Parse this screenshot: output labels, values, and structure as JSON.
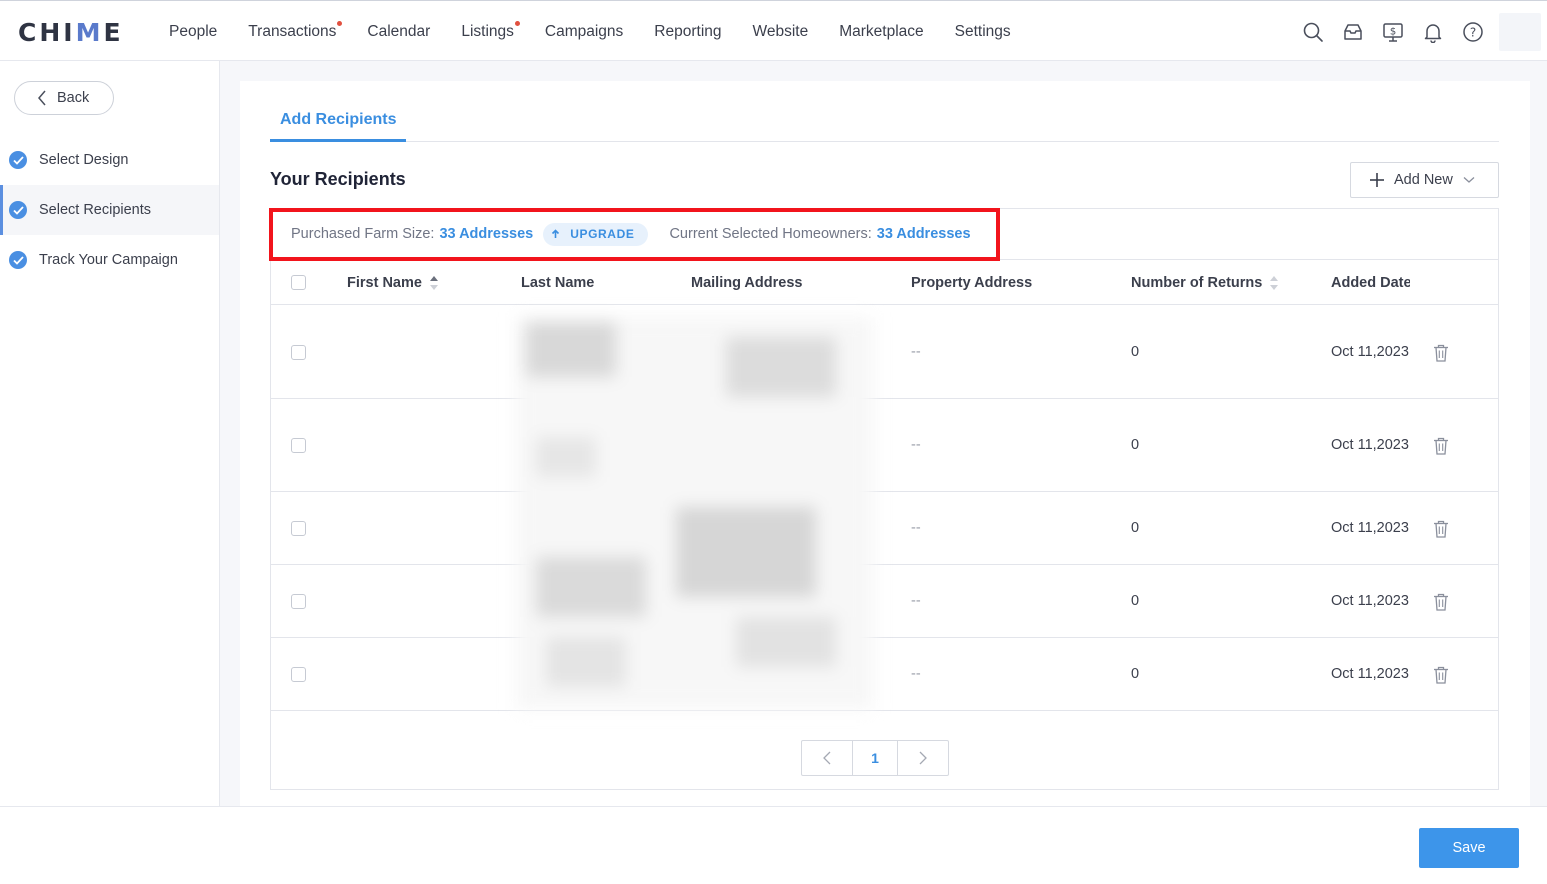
{
  "app": {
    "logo": "CHIME"
  },
  "nav": [
    {
      "label": "People",
      "dot": false
    },
    {
      "label": "Transactions",
      "dot": true
    },
    {
      "label": "Calendar",
      "dot": false
    },
    {
      "label": "Listings",
      "dot": true
    },
    {
      "label": "Campaigns",
      "dot": false
    },
    {
      "label": "Reporting",
      "dot": false
    },
    {
      "label": "Website",
      "dot": false
    },
    {
      "label": "Marketplace",
      "dot": false
    },
    {
      "label": "Settings",
      "dot": false
    }
  ],
  "header_icons": [
    "search-icon",
    "inbox-icon",
    "billing-icon",
    "bell-icon",
    "help-icon"
  ],
  "sidebar": {
    "back_label": "Back",
    "steps": [
      {
        "label": "Select Design",
        "done": true,
        "active": false
      },
      {
        "label": "Select Recipients",
        "done": true,
        "active": true
      },
      {
        "label": "Track Your Campaign",
        "done": true,
        "active": false
      }
    ]
  },
  "main": {
    "tab": "Add Recipients",
    "section_title": "Your Recipients",
    "add_new_label": "Add New",
    "info": {
      "farm_label": "Purchased Farm Size:",
      "farm_value": "33 Addresses",
      "upgrade_label": "UPGRADE",
      "selected_label": "Current Selected Homeowners:",
      "selected_value": "33 Addresses"
    },
    "columns": [
      "First Name",
      "Last Name",
      "Mailing Address",
      "Property Address",
      "Number of Returns",
      "Added Date"
    ],
    "rows": [
      {
        "first_name": "",
        "last_name": "",
        "mailing_address": "",
        "property_address": "--",
        "returns": "0",
        "added_date": "Oct 11,2023"
      },
      {
        "first_name": "",
        "last_name": "",
        "mailing_address": "",
        "property_address": "--",
        "returns": "0",
        "added_date": "Oct 11,2023"
      },
      {
        "first_name": "",
        "last_name": "",
        "mailing_address": "",
        "property_address": "--",
        "returns": "0",
        "added_date": "Oct 11,2023"
      },
      {
        "first_name": "",
        "last_name": "",
        "mailing_address": "",
        "property_address": "--",
        "returns": "0",
        "added_date": "Oct 11,2023"
      },
      {
        "first_name": "",
        "last_name": "",
        "mailing_address": "",
        "property_address": "--",
        "returns": "0",
        "added_date": "Oct 11,2023"
      }
    ],
    "pagination": {
      "current_page": "1"
    }
  },
  "footer": {
    "save_label": "Save"
  },
  "colors": {
    "accent": "#3a8ee0",
    "highlight_border": "#f2141c",
    "nav_dot": "#e1503f",
    "save_button": "#3d95ea"
  }
}
